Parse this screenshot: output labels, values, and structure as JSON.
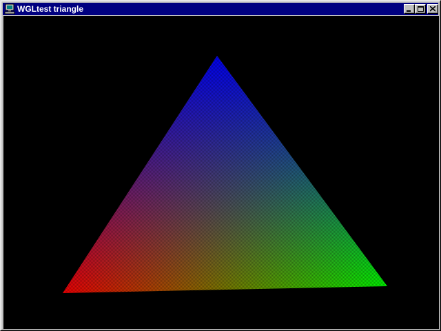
{
  "window": {
    "title": "WGLtest triangle",
    "icon": "computer-icon",
    "controls": [
      "minimize-icon",
      "maximize-icon",
      "close-icon"
    ],
    "colors": {
      "titlebar": "#000080",
      "title_text": "#ffffff",
      "chrome": "#c0c0c0",
      "client_background": "#000000"
    }
  },
  "triangle": {
    "vertex_colors": {
      "top": "#0000ff",
      "bottom_left": "#ff0000",
      "bottom_right": "#00ff00"
    }
  }
}
